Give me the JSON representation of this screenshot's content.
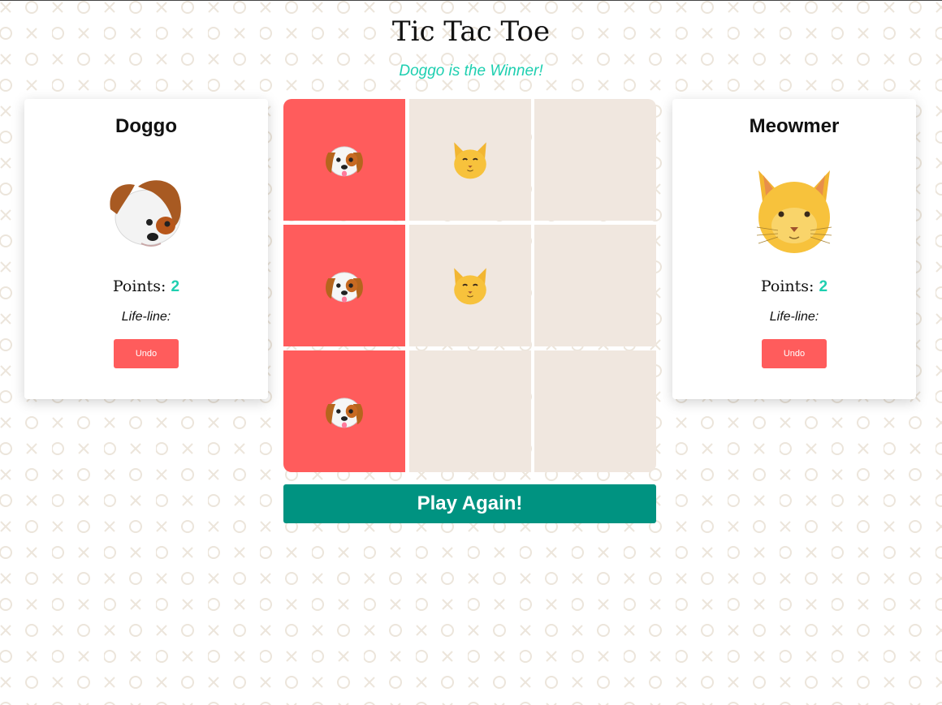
{
  "title": "Tic Tac Toe",
  "status_text": "Doggo is the Winner!",
  "colors": {
    "accent_text": "#1ecfb0",
    "win_cell": "#ff5c5c",
    "empty_cell": "#f0e7df",
    "undo_button": "#ff5c5c",
    "play_again": "#009381",
    "pattern": "#ece5db"
  },
  "players": [
    {
      "name": "Doggo",
      "avatar_icon": "dog-face-icon",
      "points_label": "Points:",
      "points": "2",
      "lifeline_label": "Life-line:",
      "undo_label": "Undo"
    },
    {
      "name": "Meowmer",
      "avatar_icon": "cat-face-icon",
      "points_label": "Points:",
      "points": "2",
      "lifeline_label": "Life-line:",
      "undo_label": "Undo"
    }
  ],
  "board": {
    "cells": [
      "dog",
      "cat",
      "",
      "dog",
      "cat",
      "",
      "dog",
      "",
      ""
    ],
    "winning_cells": [
      0,
      3,
      6
    ]
  },
  "play_again_label": "Play Again!"
}
